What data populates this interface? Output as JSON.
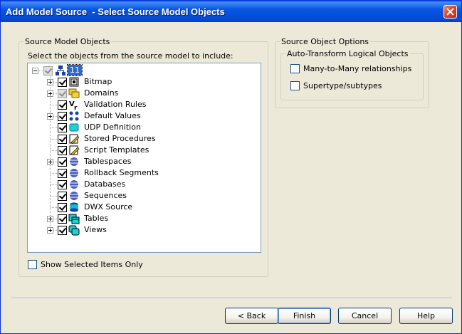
{
  "window": {
    "title": "Add Model Source  - Select Source Model Objects"
  },
  "source_group": {
    "legend": "Source Model Objects",
    "instruction": "Select the objects from the source model to include:",
    "root": {
      "label": "11",
      "checked": true
    },
    "items": [
      {
        "label": "Bitmap",
        "checked": true,
        "expandable": true
      },
      {
        "label": "Domains",
        "checked": true,
        "expandable": true,
        "grey": true
      },
      {
        "label": "Validation Rules",
        "checked": true,
        "expandable": false
      },
      {
        "label": "Default Values",
        "checked": true,
        "expandable": true
      },
      {
        "label": "UDP Definition",
        "checked": true,
        "expandable": false
      },
      {
        "label": "Stored Procedures",
        "checked": true,
        "expandable": false
      },
      {
        "label": "Script Templates",
        "checked": true,
        "expandable": false
      },
      {
        "label": "Tablespaces",
        "checked": true,
        "expandable": true
      },
      {
        "label": "Rollback Segments",
        "checked": true,
        "expandable": false
      },
      {
        "label": "Databases",
        "checked": true,
        "expandable": false
      },
      {
        "label": "Sequences",
        "checked": true,
        "expandable": false
      },
      {
        "label": "DWX Source",
        "checked": true,
        "expandable": false
      },
      {
        "label": "Tables",
        "checked": true,
        "expandable": true
      },
      {
        "label": "Views",
        "checked": true,
        "expandable": true
      }
    ],
    "show_selected_only": {
      "label": "Show Selected Items Only",
      "checked": false
    }
  },
  "options_group": {
    "legend": "Source Object Options",
    "sub_legend": "Auto-Transform Logical Objects",
    "many_to_many": {
      "label": "Many-to-Many relationships",
      "checked": false
    },
    "supertype": {
      "label": "Supertype/subtypes",
      "checked": false
    }
  },
  "buttons": {
    "back": "< Back",
    "finish": "Finish",
    "cancel": "Cancel",
    "help": "Help"
  },
  "colors": {
    "titlebar": "#0856e3",
    "dialog_bg": "#ece9d8",
    "close_button": "#d8452b"
  }
}
